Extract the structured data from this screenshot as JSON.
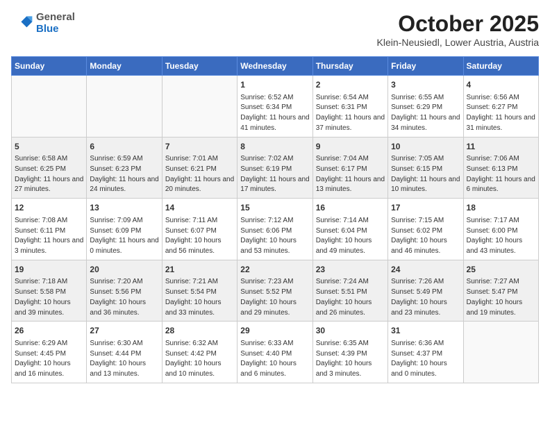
{
  "header": {
    "logo_general": "General",
    "logo_blue": "Blue",
    "month_title": "October 2025",
    "subtitle": "Klein-Neusiedl, Lower Austria, Austria"
  },
  "days_of_week": [
    "Sunday",
    "Monday",
    "Tuesday",
    "Wednesday",
    "Thursday",
    "Friday",
    "Saturday"
  ],
  "weeks": [
    [
      {
        "day": "",
        "info": ""
      },
      {
        "day": "",
        "info": ""
      },
      {
        "day": "",
        "info": ""
      },
      {
        "day": "1",
        "info": "Sunrise: 6:52 AM\nSunset: 6:34 PM\nDaylight: 11 hours and 41 minutes."
      },
      {
        "day": "2",
        "info": "Sunrise: 6:54 AM\nSunset: 6:31 PM\nDaylight: 11 hours and 37 minutes."
      },
      {
        "day": "3",
        "info": "Sunrise: 6:55 AM\nSunset: 6:29 PM\nDaylight: 11 hours and 34 minutes."
      },
      {
        "day": "4",
        "info": "Sunrise: 6:56 AM\nSunset: 6:27 PM\nDaylight: 11 hours and 31 minutes."
      }
    ],
    [
      {
        "day": "5",
        "info": "Sunrise: 6:58 AM\nSunset: 6:25 PM\nDaylight: 11 hours and 27 minutes."
      },
      {
        "day": "6",
        "info": "Sunrise: 6:59 AM\nSunset: 6:23 PM\nDaylight: 11 hours and 24 minutes."
      },
      {
        "day": "7",
        "info": "Sunrise: 7:01 AM\nSunset: 6:21 PM\nDaylight: 11 hours and 20 minutes."
      },
      {
        "day": "8",
        "info": "Sunrise: 7:02 AM\nSunset: 6:19 PM\nDaylight: 11 hours and 17 minutes."
      },
      {
        "day": "9",
        "info": "Sunrise: 7:04 AM\nSunset: 6:17 PM\nDaylight: 11 hours and 13 minutes."
      },
      {
        "day": "10",
        "info": "Sunrise: 7:05 AM\nSunset: 6:15 PM\nDaylight: 11 hours and 10 minutes."
      },
      {
        "day": "11",
        "info": "Sunrise: 7:06 AM\nSunset: 6:13 PM\nDaylight: 11 hours and 6 minutes."
      }
    ],
    [
      {
        "day": "12",
        "info": "Sunrise: 7:08 AM\nSunset: 6:11 PM\nDaylight: 11 hours and 3 minutes."
      },
      {
        "day": "13",
        "info": "Sunrise: 7:09 AM\nSunset: 6:09 PM\nDaylight: 11 hours and 0 minutes."
      },
      {
        "day": "14",
        "info": "Sunrise: 7:11 AM\nSunset: 6:07 PM\nDaylight: 10 hours and 56 minutes."
      },
      {
        "day": "15",
        "info": "Sunrise: 7:12 AM\nSunset: 6:06 PM\nDaylight: 10 hours and 53 minutes."
      },
      {
        "day": "16",
        "info": "Sunrise: 7:14 AM\nSunset: 6:04 PM\nDaylight: 10 hours and 49 minutes."
      },
      {
        "day": "17",
        "info": "Sunrise: 7:15 AM\nSunset: 6:02 PM\nDaylight: 10 hours and 46 minutes."
      },
      {
        "day": "18",
        "info": "Sunrise: 7:17 AM\nSunset: 6:00 PM\nDaylight: 10 hours and 43 minutes."
      }
    ],
    [
      {
        "day": "19",
        "info": "Sunrise: 7:18 AM\nSunset: 5:58 PM\nDaylight: 10 hours and 39 minutes."
      },
      {
        "day": "20",
        "info": "Sunrise: 7:20 AM\nSunset: 5:56 PM\nDaylight: 10 hours and 36 minutes."
      },
      {
        "day": "21",
        "info": "Sunrise: 7:21 AM\nSunset: 5:54 PM\nDaylight: 10 hours and 33 minutes."
      },
      {
        "day": "22",
        "info": "Sunrise: 7:23 AM\nSunset: 5:52 PM\nDaylight: 10 hours and 29 minutes."
      },
      {
        "day": "23",
        "info": "Sunrise: 7:24 AM\nSunset: 5:51 PM\nDaylight: 10 hours and 26 minutes."
      },
      {
        "day": "24",
        "info": "Sunrise: 7:26 AM\nSunset: 5:49 PM\nDaylight: 10 hours and 23 minutes."
      },
      {
        "day": "25",
        "info": "Sunrise: 7:27 AM\nSunset: 5:47 PM\nDaylight: 10 hours and 19 minutes."
      }
    ],
    [
      {
        "day": "26",
        "info": "Sunrise: 6:29 AM\nSunset: 4:45 PM\nDaylight: 10 hours and 16 minutes."
      },
      {
        "day": "27",
        "info": "Sunrise: 6:30 AM\nSunset: 4:44 PM\nDaylight: 10 hours and 13 minutes."
      },
      {
        "day": "28",
        "info": "Sunrise: 6:32 AM\nSunset: 4:42 PM\nDaylight: 10 hours and 10 minutes."
      },
      {
        "day": "29",
        "info": "Sunrise: 6:33 AM\nSunset: 4:40 PM\nDaylight: 10 hours and 6 minutes."
      },
      {
        "day": "30",
        "info": "Sunrise: 6:35 AM\nSunset: 4:39 PM\nDaylight: 10 hours and 3 minutes."
      },
      {
        "day": "31",
        "info": "Sunrise: 6:36 AM\nSunset: 4:37 PM\nDaylight: 10 hours and 0 minutes."
      },
      {
        "day": "",
        "info": ""
      }
    ]
  ]
}
